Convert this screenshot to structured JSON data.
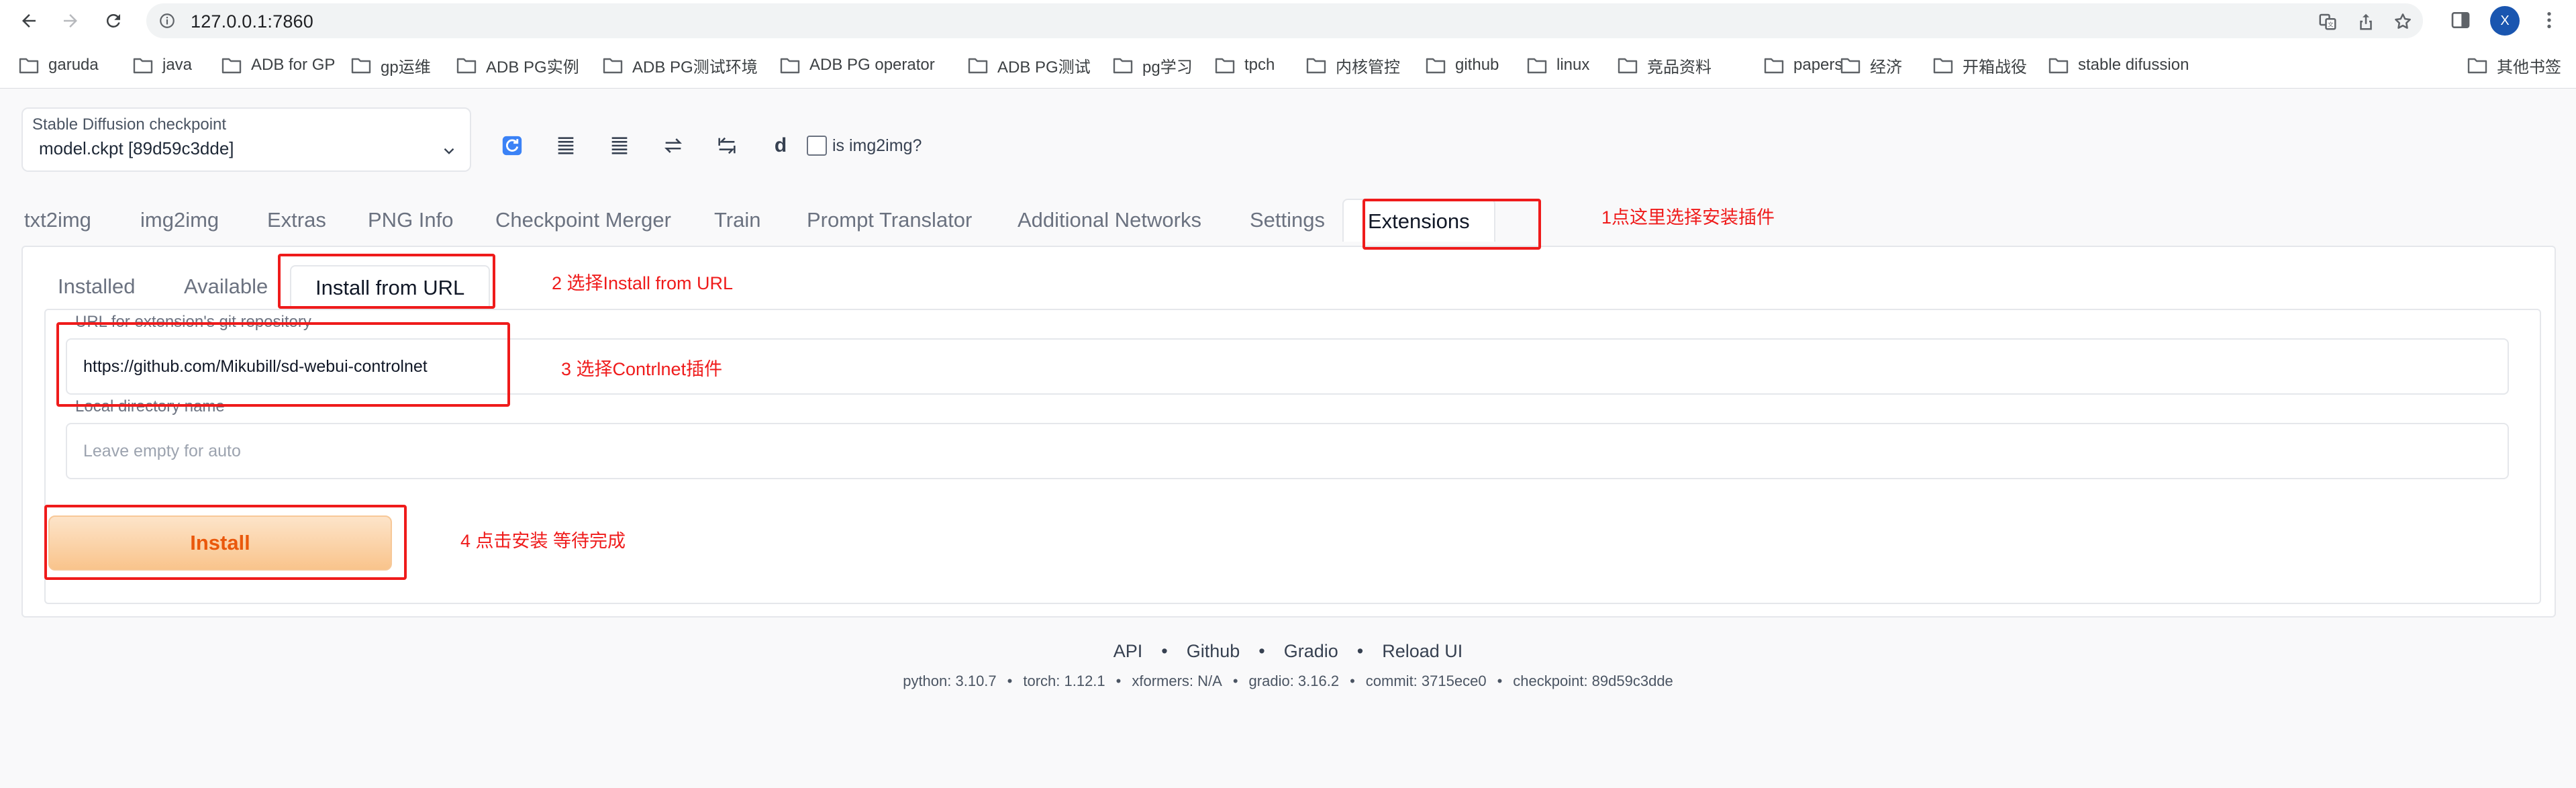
{
  "browser": {
    "url": "127.0.0.1:7860",
    "profile_initial": "X",
    "bookmarks": [
      "garuda",
      "java",
      "ADB for GP",
      "gp运维",
      "ADB PG实例",
      "ADB PG测试环境",
      "ADB PG operator",
      "ADB PG测试",
      "pg学习",
      "tpch",
      "内核管控",
      "github",
      "linux",
      "竞品资料",
      "papers",
      "经济",
      "开箱战役",
      "stable difussion"
    ],
    "other_bookmarks": "其他书签"
  },
  "checkpoint": {
    "label": "Stable Diffusion checkpoint",
    "value": "model.ckpt [89d59c3dde]"
  },
  "toolbar": {
    "d_label": "d",
    "img2img_checkbox_label": "is img2img?"
  },
  "tabs": [
    "txt2img",
    "img2img",
    "Extras",
    "PNG Info",
    "Checkpoint Merger",
    "Train",
    "Prompt Translator",
    "Additional Networks",
    "Settings",
    "Extensions"
  ],
  "subtabs": [
    "Installed",
    "Available",
    "Install from URL"
  ],
  "form": {
    "url_label": "URL for extension's git repository",
    "url_value": "https://github.com/Mikubill/sd-webui-controlnet",
    "dir_label": "Local directory name",
    "dir_placeholder": "Leave empty for auto",
    "install_label": "Install"
  },
  "annotations": {
    "a1": "1点这里选择安装插件",
    "a2": "2 选择Install from URL",
    "a3": "3 选择Contrlnet插件",
    "a4": "4 点击安装 等待完成"
  },
  "footer": {
    "links": [
      "API",
      "Github",
      "Gradio",
      "Reload UI"
    ],
    "separator": "•",
    "meta": [
      "python: 3.10.7",
      "torch: 1.12.1",
      "xformers: N/A",
      "gradio: 3.16.2",
      "commit: 3715ece0",
      "checkpoint: 89d59c3dde"
    ]
  },
  "colors": {
    "accent": "#ea580c",
    "annotation": "#ef1b1b",
    "profile": "#1a56b0"
  }
}
